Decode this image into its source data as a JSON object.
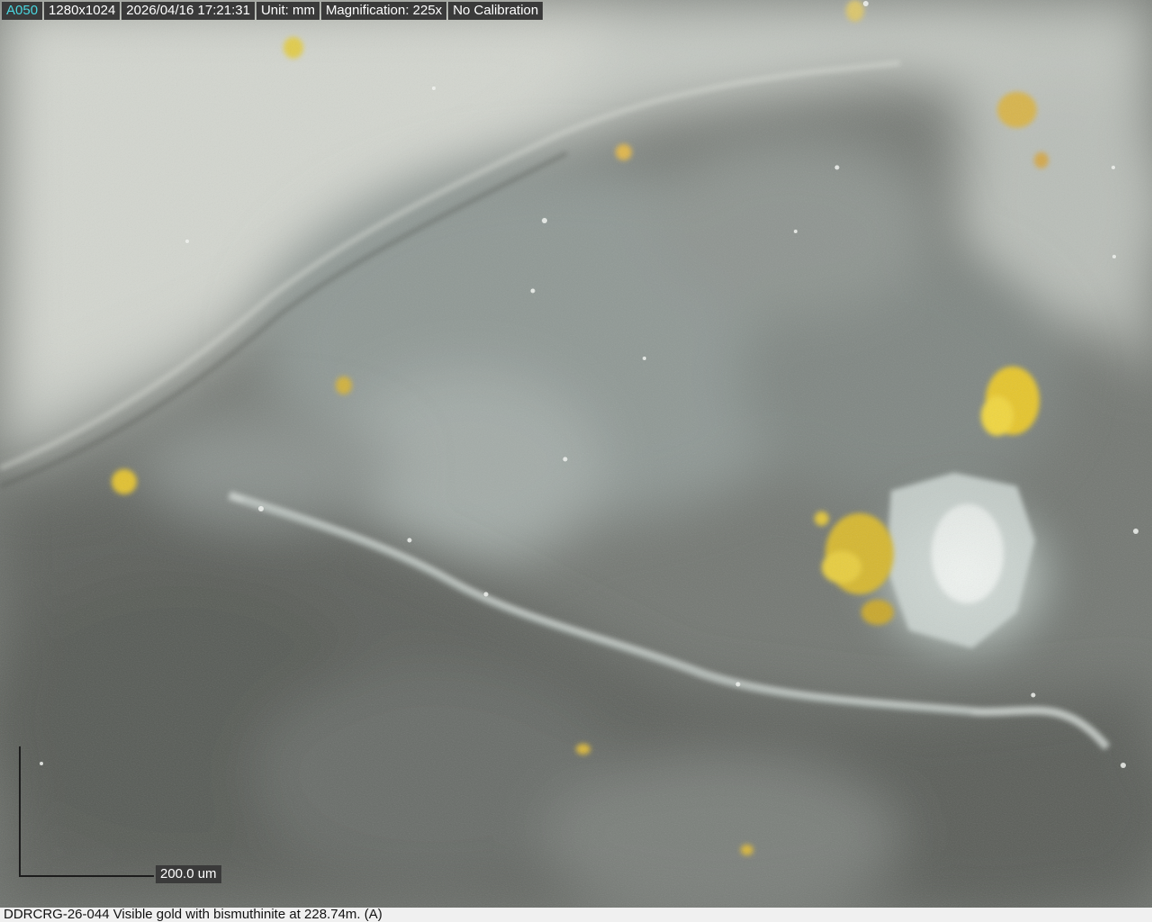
{
  "overlay": {
    "channel": "A050",
    "resolution": "1280x1024",
    "timestamp": "2026/04/16 17:21:31",
    "unit": "Unit: mm",
    "magnification": "Magnification:  225x",
    "calibration": "No Calibration"
  },
  "scale_bar": {
    "label": "200.0 um"
  },
  "caption": {
    "text": "DDRCRG-26-044 Visible gold with bismuthinite at 228.74m. (A)"
  },
  "colors": {
    "hud_background": "#3a3a3a",
    "channel_accent": "#4ad7e0",
    "gold": "#e6c52a",
    "bismuthinite": "#d8e0dc"
  }
}
